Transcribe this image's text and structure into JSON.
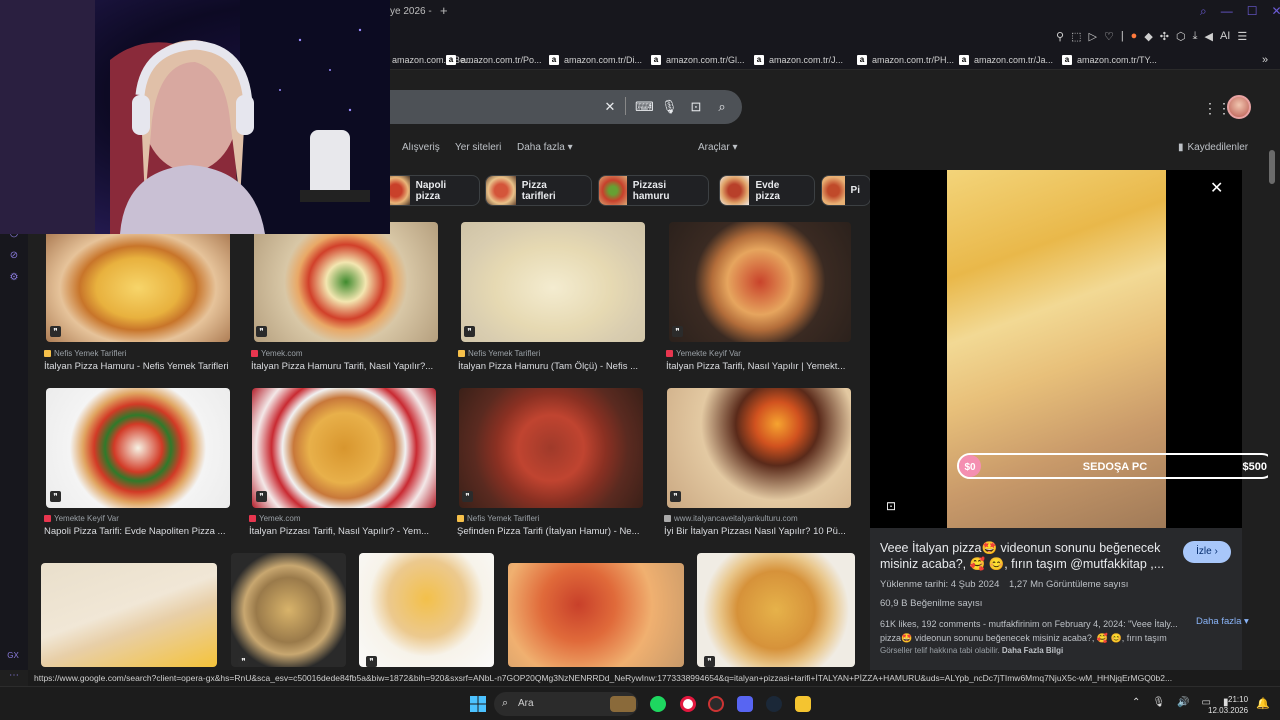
{
  "browser": {
    "tab_title_fragment": "ye 2026 -",
    "new_tab_symbol": "+",
    "bookmarks": [
      "amazon.com.tr/Be...",
      "amazon.com.tr/Po...",
      "amazon.com.tr/Di...",
      "amazon.com.tr/Gl...",
      "amazon.com.tr/J...",
      "amazon.com.tr/PH...",
      "amazon.com.tr/Ja...",
      "amazon.com.tr/TY..."
    ],
    "ai_label": "AI"
  },
  "search": {
    "nav": {
      "shopping": "Alışveriş",
      "sites": "Yer siteleri",
      "more": "Daha fazla",
      "tools": "Araçlar",
      "saved": "Kaydedilenler"
    },
    "chips": [
      "Napoli pizza",
      "Pizza tarifleri",
      "Pizzasi hamuru",
      "Evde pizza",
      "Pi"
    ]
  },
  "results": [
    {
      "source": "Nefis Yemek Tarifleri",
      "title": "İtalyan Pizza Hamuru - Nefis Yemek Tarifleri"
    },
    {
      "source": "Yemek.com",
      "title": "İtalyan Pizza Hamuru Tarifi, Nasıl Yapılır?..."
    },
    {
      "source": "Nefis Yemek Tarifleri",
      "title": "İtalyan Pizza Hamuru (Tam Ölçü) - Nefis ..."
    },
    {
      "source": "Yemekte Keyif Var",
      "title": "İtalyan Pizza Tarifi, Nasıl Yapılır | Yemekt..."
    },
    {
      "source": "Yemekte Keyif Var",
      "title": "Napoli Pizza Tarifi: Evde Napoliten Pizza ..."
    },
    {
      "source": "Yemek.com",
      "title": "İtalyan Pizzası Tarifi, Nasıl Yapılır? - Yem..."
    },
    {
      "source": "Nefis Yemek Tarifleri",
      "title": "Şefinden Pizza Tarifi (İtalyan Hamur) - Ne..."
    },
    {
      "source": "www.italyancaveitalyankulturu.com",
      "title": "İyi Bir İtalyan Pizzası Nasıl Yapılır? 10 Pü..."
    }
  ],
  "preview": {
    "overlay_left": "$0",
    "overlay_center": "SEDOŞA PC",
    "overlay_right": "$500",
    "title": "Veee İtalyan pizza🤩 videonun sonunu beğenecek misiniz acaba?, 🥰 😊, fırın taşım @mutfakkitap ,...",
    "watch_button": "İzle",
    "upload_date": "Yüklenme tarihi: 4 Şub 2024",
    "views": "1,27 Mn Görüntüleme sayısı",
    "likes": "60,9 B Beğenilme sayısı",
    "description": "61K likes, 192 comments - mutfakfirinim on February 4, 2024: \"Veee İtaly... pizza🤩 videonun sonunu beğenecek misiniz acaba?, 🥰 😊, fırın taşım",
    "more_link": "Daha fazla",
    "licence_note": "Görseller telif hakkına tabi olabilir.",
    "licence_link": "Daha Fazla Bilgi"
  },
  "status_url": "https://www.google.com/search?client=opera-gx&hs=RnU&sca_esv=c50016dede84fb5a&biw=1872&bih=920&sxsrf=ANbL-n7GOP20QMg3NzNENRRDd_NeRywInw:1773338994654&q=italyan+pizzasi+tarifi+İTALYAN+PİZZA+HAMURU&uds=ALYpb_ncDc7jTImw6Mmq7NjuX5c-wM_HHNjqErMGQ0b2...",
  "taskbar": {
    "search_label": "Ara",
    "time": "21:10",
    "date": "12.03.2026"
  },
  "sidebar_label": "GX"
}
